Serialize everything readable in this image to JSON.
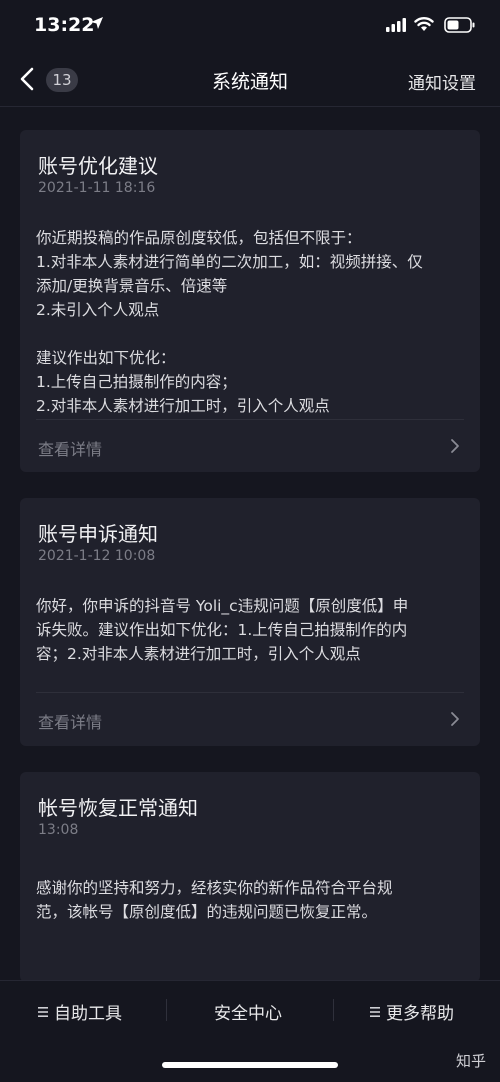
{
  "status_bar": {
    "time": "13:22"
  },
  "nav": {
    "badge": "13",
    "title": "系统通知",
    "settings": "通知设置"
  },
  "cards": [
    {
      "title": "账号优化建议",
      "date": "2021-1-11 18:16",
      "body": "你近期投稿的作品原创度较低，包括但不限于：\n1.对非本人素材进行简单的二次加工，如：视频拼接、仅\n添加/更换背景音乐、倍速等\n2.未引入个人观点\n\n建议作出如下优化：\n1.上传自己拍摄制作的内容；\n2.对非本人素材进行加工时，引入个人观点",
      "detail": "查看详情"
    },
    {
      "title": "账号申诉通知",
      "date": "2021-1-12 10:08",
      "body": "你好，你申诉的抖音号 Yoli_c违规问题【原创度低】申\n诉失败。建议作出如下优化：1.上传自己拍摄制作的内\n容；2.对非本人素材进行加工时，引入个人观点",
      "detail": "查看详情"
    },
    {
      "title": "帐号恢复正常通知",
      "date": "13:08",
      "body": "感谢你的坚持和努力，经核实你的新作品符合平台规\n范，该帐号【原创度低】的违规问题已恢复正常。"
    }
  ],
  "bottom_bar": {
    "tools": "自助工具",
    "security": "安全中心",
    "help": "更多帮助"
  },
  "watermark": "知乎"
}
